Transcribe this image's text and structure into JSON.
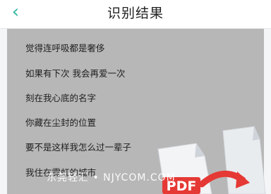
{
  "header": {
    "title": "识别结果",
    "back_icon": "chevron-left-icon"
  },
  "result": {
    "lines": [
      "觉得连呼吸都是奢侈",
      "如果有下次 我会再爱一次",
      "刻在我心底的名字",
      "你藏在尘封的位置",
      "要不是这样我怎么过一辈子",
      "我住在霓虹的城市"
    ]
  },
  "overlay": {
    "watermark": "东莞轻汇 • NJYCOM.COM",
    "badge_text": "PDF",
    "badge_color": "#e53935",
    "accent_color": "#35b8a4"
  }
}
